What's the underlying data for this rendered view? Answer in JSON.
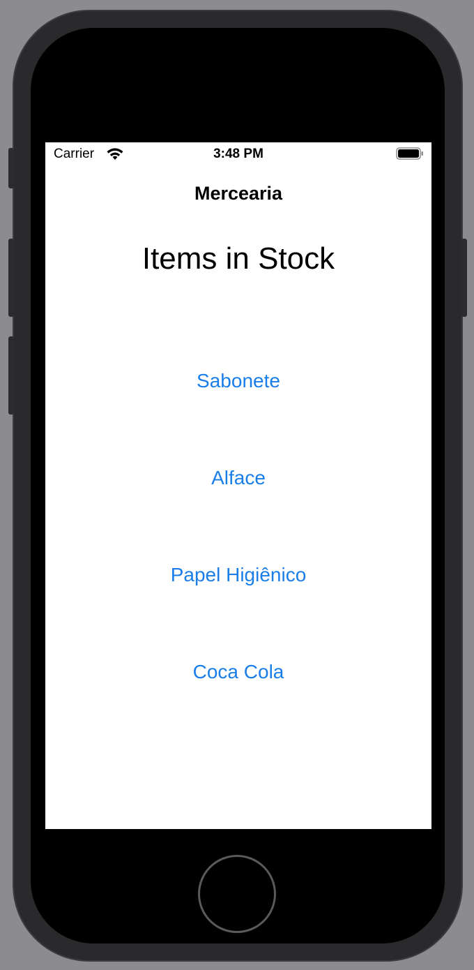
{
  "status_bar": {
    "carrier": "Carrier",
    "time": "3:48 PM",
    "wifi_icon": "wifi-icon",
    "battery_icon": "battery-full-icon"
  },
  "nav": {
    "title": "Mercearia"
  },
  "main": {
    "heading": "Items in Stock",
    "items": [
      {
        "label": "Sabonete"
      },
      {
        "label": "Alface"
      },
      {
        "label": "Papel Higiênico"
      },
      {
        "label": "Coca Cola"
      }
    ]
  },
  "colors": {
    "accent": "#1a7ee8",
    "background": "#ffffff",
    "bezel": "#000000"
  }
}
